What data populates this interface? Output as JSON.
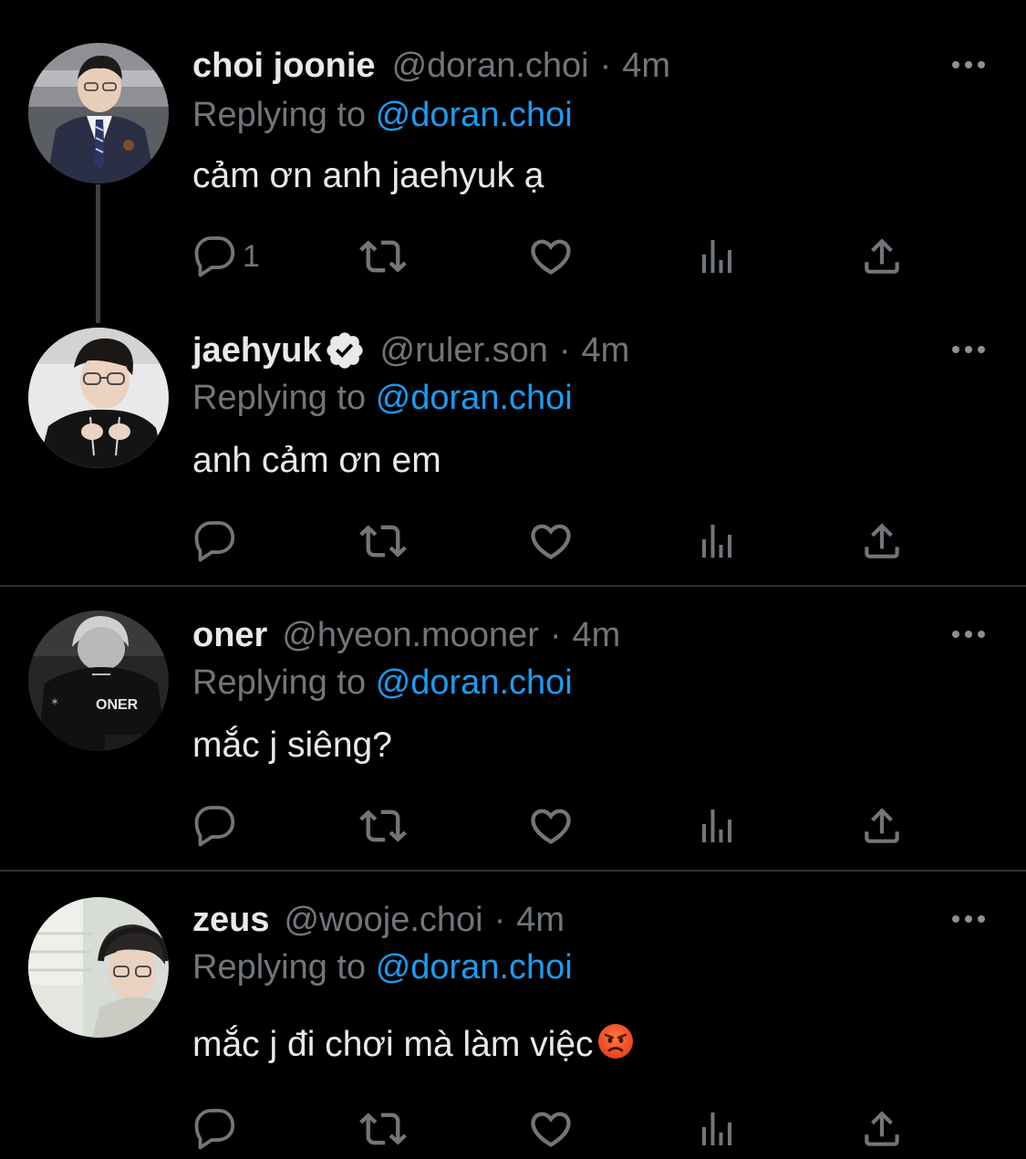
{
  "colors": {
    "background": "#000000",
    "text": "#e7e9ea",
    "muted": "#71767b",
    "accent": "#1d9bf0",
    "divider": "#2f3336"
  },
  "reply_prefix": "Replying to",
  "tweets": [
    {
      "name": "choi joonie",
      "handle": "@doran.choi",
      "time": "4m",
      "replying_to": "@doran.choi",
      "text": "cảm ơn anh jaehyuk ạ",
      "reply_count": "1",
      "verified": false
    },
    {
      "name": "jaehyuk",
      "handle": "@ruler.son",
      "time": "4m",
      "replying_to": "@doran.choi",
      "text": "anh cảm ơn em",
      "reply_count": "",
      "verified": true
    },
    {
      "name": "oner",
      "handle": "@hyeon.mooner",
      "time": "4m",
      "replying_to": "@doran.choi",
      "text": "mắc j siêng?",
      "reply_count": "",
      "verified": false,
      "avatar_jersey_text": "ONER"
    },
    {
      "name": "zeus",
      "handle": "@wooje.choi",
      "time": "4m",
      "replying_to": "@doran.choi",
      "text": "mắc j đi chơi mà làm việc",
      "emoji": "angry-face",
      "reply_count": "",
      "verified": false
    }
  ],
  "icons": {
    "reply": "reply-icon",
    "retweet": "retweet-icon",
    "like": "heart-icon",
    "views": "views-icon",
    "share": "share-icon",
    "more": "more-icon",
    "verified": "verified-badge-icon"
  }
}
